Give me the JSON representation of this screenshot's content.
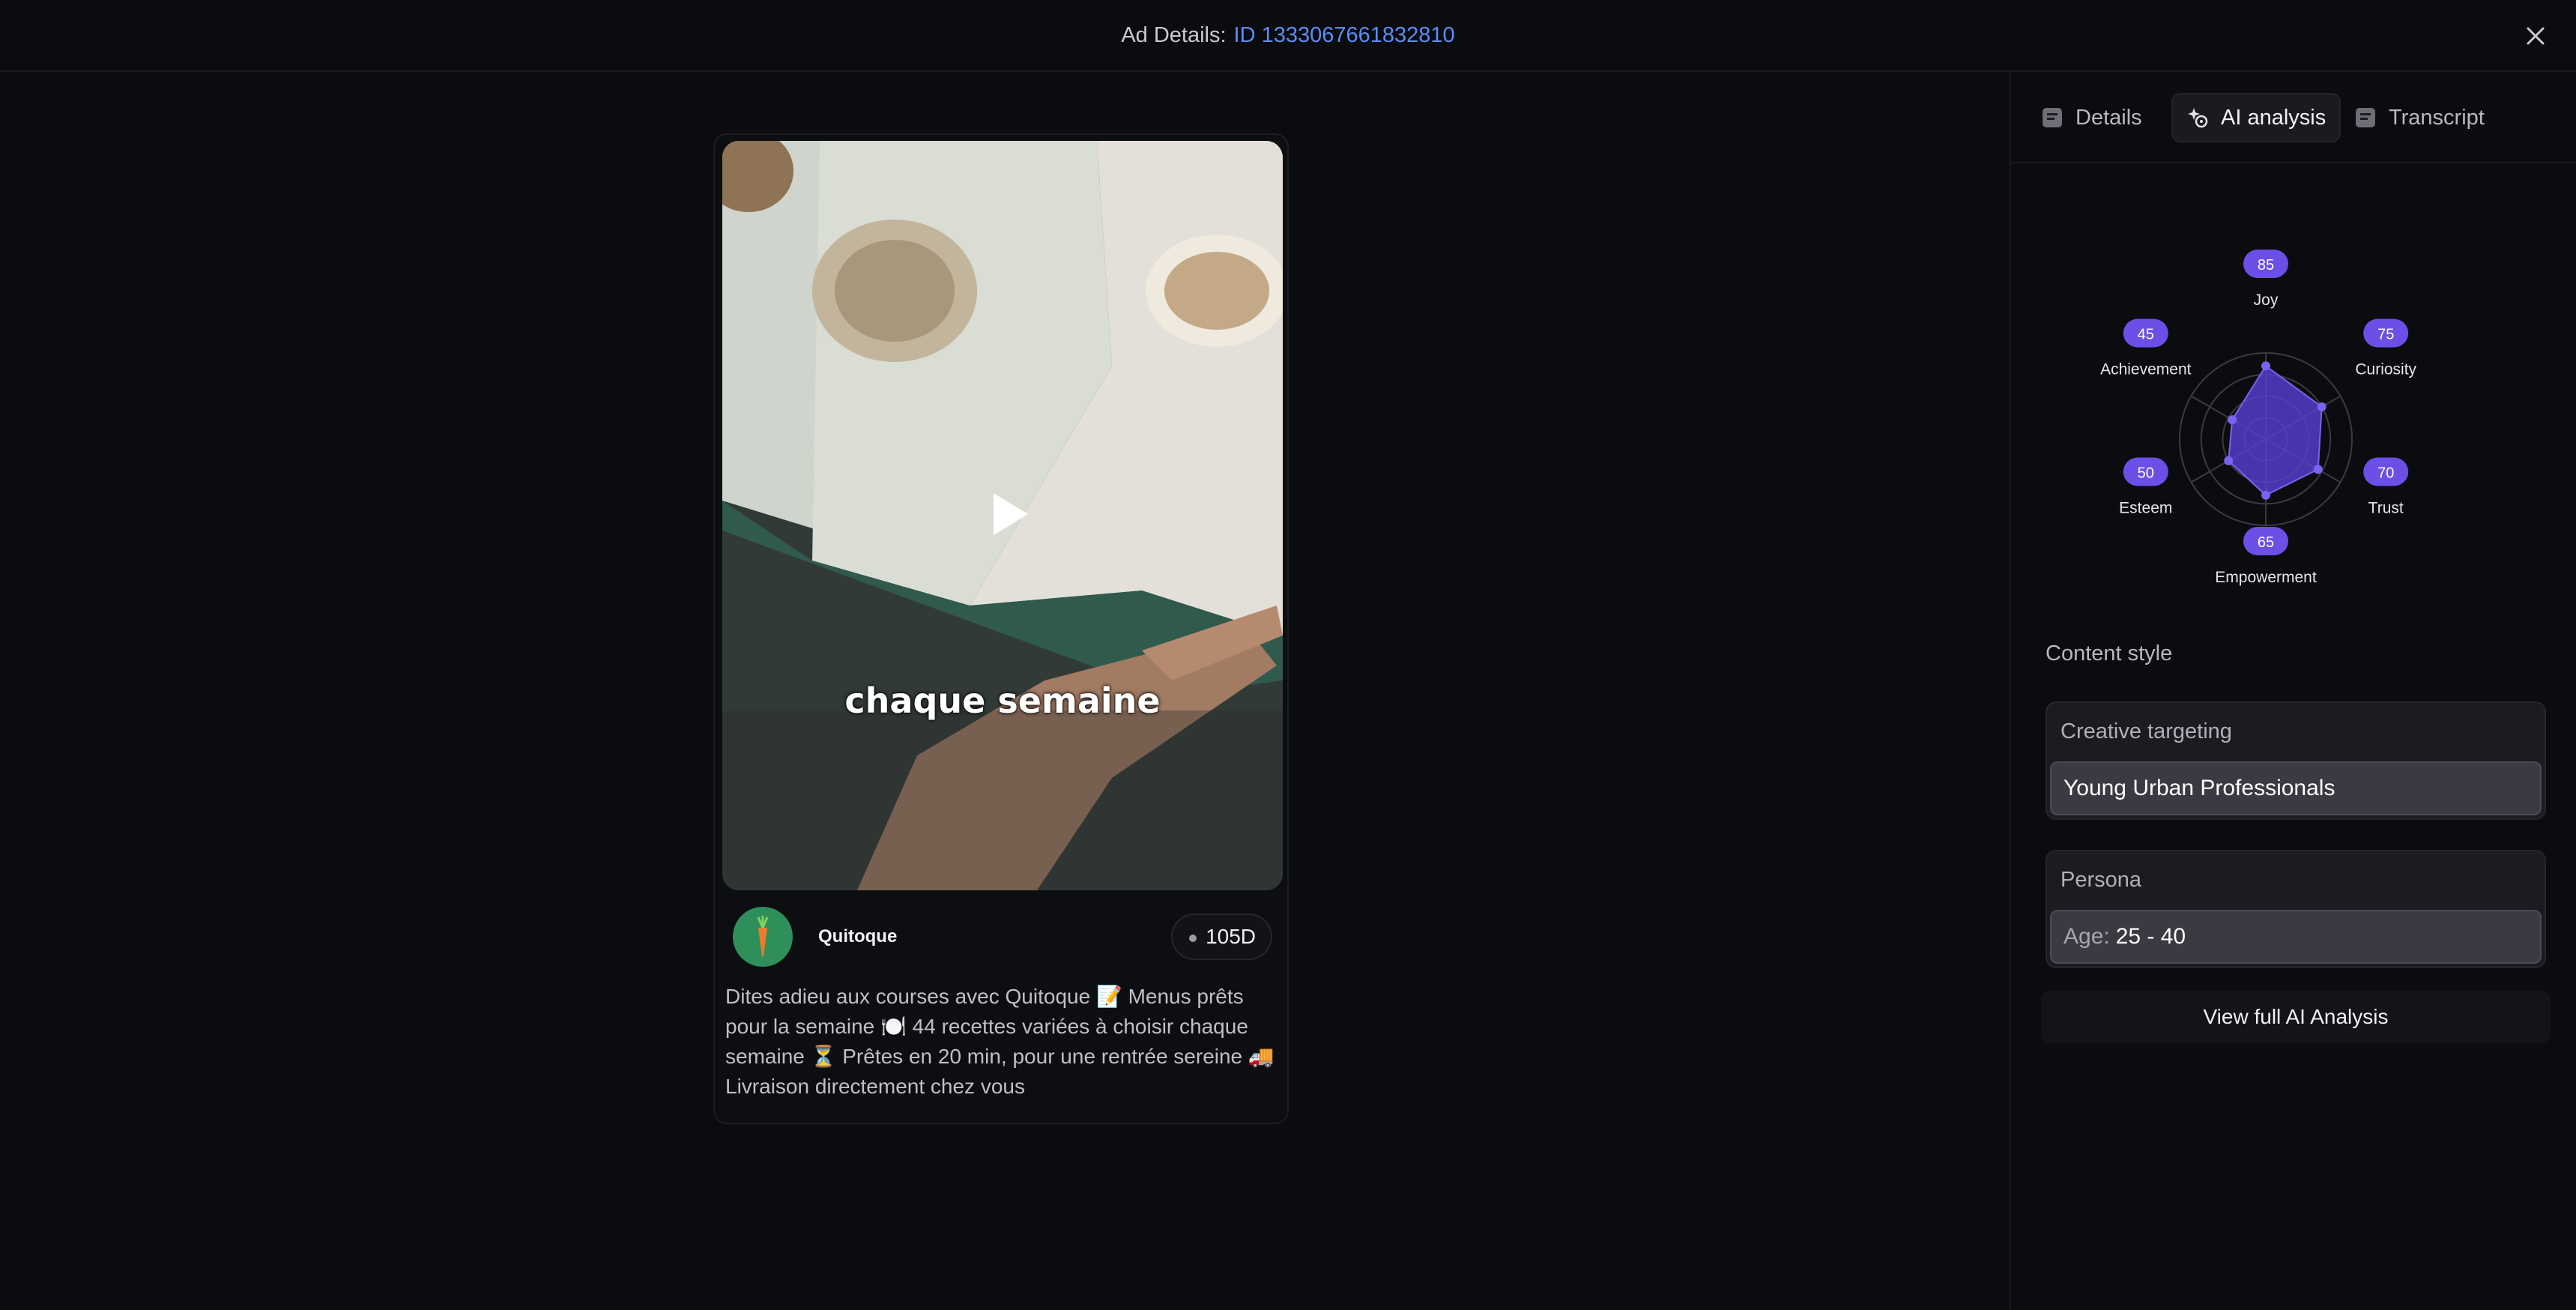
{
  "header": {
    "label": "Ad Details:",
    "ad_id": "ID 1333067661832810"
  },
  "ad": {
    "caption": "chaque semaine",
    "advertiser_name": "Quitoque",
    "days_active": "105D",
    "text": "Dites adieu aux courses avec Quitoque 📝 Menus prêts pour la semaine 🍽️ 44 recettes variées à choisir chaque semaine ⏳ Prêtes en 20 min, pour une rentrée sereine 🚚 Livraison directement chez vous"
  },
  "tabs": [
    {
      "label": "Details",
      "icon": "document-icon",
      "active": false
    },
    {
      "label": "AI analysis",
      "icon": "sparkle-icon",
      "active": true
    },
    {
      "label": "Transcript",
      "icon": "document-icon",
      "active": false
    }
  ],
  "chart_data": {
    "type": "radar",
    "categories": [
      "Joy",
      "Curiosity",
      "Trust",
      "Empowerment",
      "Esteem",
      "Achievement"
    ],
    "values": [
      85,
      75,
      70,
      65,
      50,
      45
    ],
    "range": [
      0,
      100
    ],
    "color": "#6b4fe6"
  },
  "content_style": {
    "title": "Content style",
    "creative_targeting": {
      "title": "Creative targeting",
      "value": "Young Urban Professionals"
    },
    "persona": {
      "title": "Persona",
      "age_label": "Age:",
      "age_value": "25 - 40"
    },
    "view_full_label": "View full AI Analysis"
  },
  "colors": {
    "accent_link": "#5b8df6",
    "radar_fill": "#5a3fd4",
    "badge": "#6b4fe6"
  }
}
